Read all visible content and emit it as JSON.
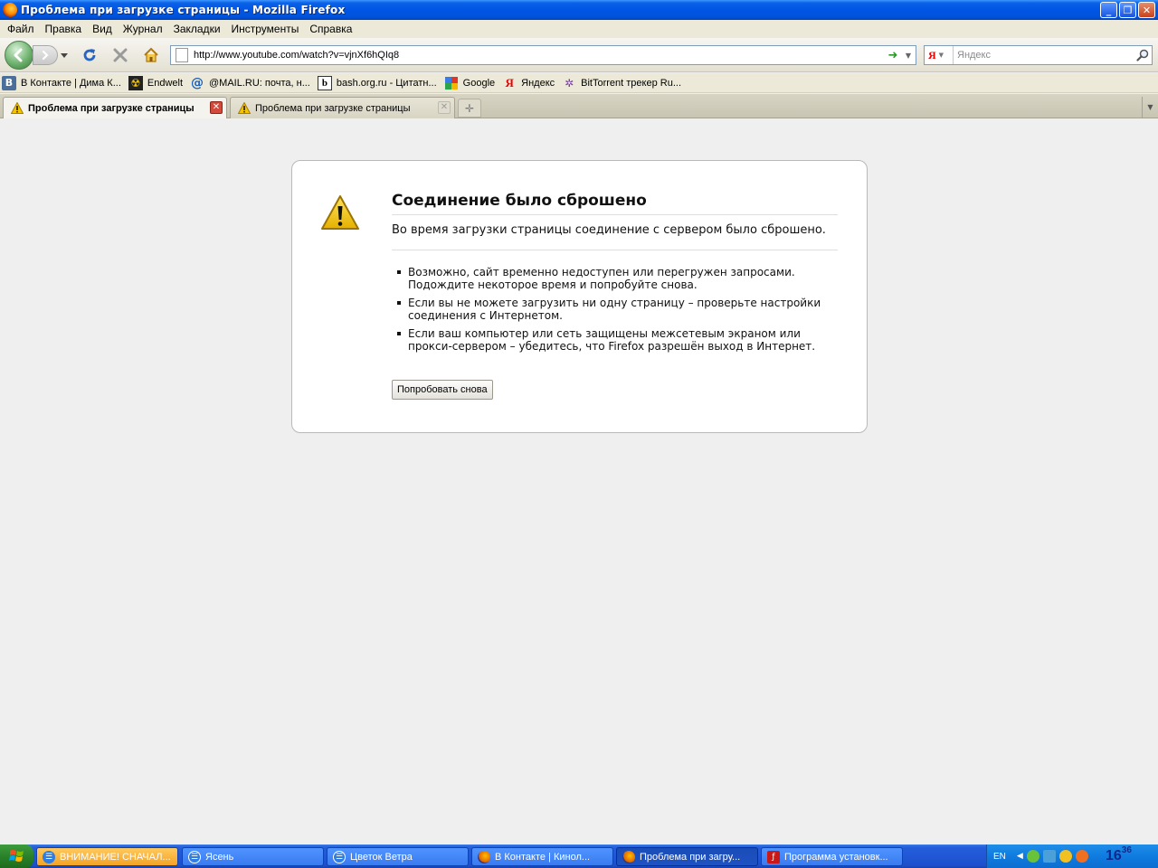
{
  "window": {
    "title": "Проблема при загрузке страницы - Mozilla Firefox"
  },
  "menu": [
    "Файл",
    "Правка",
    "Вид",
    "Журнал",
    "Закладки",
    "Инструменты",
    "Справка"
  ],
  "navbar": {
    "url": "http://www.youtube.com/watch?v=vjnXf6hQIq8",
    "search_placeholder": "Яндекс",
    "search_engine_letter": "Я"
  },
  "bookmarks": [
    {
      "label": "В Контакте | Дима К...",
      "icon": "vk-icon"
    },
    {
      "label": "Endwelt",
      "icon": "radiation-icon"
    },
    {
      "label": "@MAIL.RU: почта, н...",
      "icon": "mailru-icon"
    },
    {
      "label": "bash.org.ru - Цитатн...",
      "icon": "bash-icon"
    },
    {
      "label": "Google",
      "icon": "google-icon"
    },
    {
      "label": "Яндекс",
      "icon": "yandex-icon"
    },
    {
      "label": "BitTorrent трекер Ru...",
      "icon": "torrent-icon"
    }
  ],
  "tabs": [
    {
      "label": "Проблема при загрузке страницы",
      "active": true
    },
    {
      "label": "Проблема при загрузке страницы",
      "active": false
    }
  ],
  "error": {
    "title": "Соединение было сброшено",
    "description": "Во время загрузки страницы соединение с сервером было сброшено.",
    "items": [
      "Возможно, сайт временно недоступен или перегружен запросами. Подождите некоторое время и попробуйте снова.",
      "Если вы не можете загрузить ни одну страницу – проверьте настройки соединения с Интернетом.",
      "Если ваш компьютер или сеть защищены межсетевым экраном или прокси-сервером – убедитесь, что Firefox разрешён выход в Интернет."
    ],
    "retry_label": "Попробовать снова"
  },
  "taskbar": {
    "tasks": [
      {
        "label": "ВНИМАНИЕ! СНАЧАЛ...",
        "icon": "chat-icon",
        "state": "flash"
      },
      {
        "label": "Ясень",
        "icon": "chat-icon",
        "state": "normal"
      },
      {
        "label": "Цветок Ветра",
        "icon": "chat-icon",
        "state": "normal"
      },
      {
        "label": "В Контакте | Кинол...",
        "icon": "firefox-icon",
        "state": "normal"
      },
      {
        "label": "Проблема при загру...",
        "icon": "firefox-icon",
        "state": "active"
      },
      {
        "label": "Программа установк...",
        "icon": "flash-installer-icon",
        "state": "normal"
      }
    ],
    "lang": "EN",
    "clock_hour": "16",
    "clock_min": "36"
  },
  "colors": {
    "titlebar": "#0055e3",
    "warning_yellow": "#f5c400",
    "tab_close_red": "#d24a3c",
    "taskbar_blue": "#245edb"
  }
}
